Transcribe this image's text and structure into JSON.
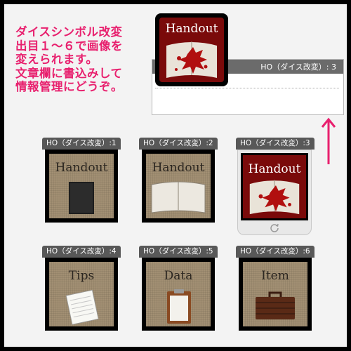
{
  "instructions": {
    "lines": [
      "ダイスシンボル改変",
      "出目１～６で画像を",
      "変えられます。",
      "文章欄に書込みして",
      "情報管理にどうぞ。"
    ]
  },
  "top_card": {
    "title": "Handout"
  },
  "panel": {
    "header": "HO（ダイス改変）: 3"
  },
  "cards": [
    {
      "label": "HO（ダイス改変）:1",
      "title": "Handout",
      "image": "closed-book-icon"
    },
    {
      "label": "HO（ダイス改変）:2",
      "title": "Handout",
      "image": "open-book-icon"
    },
    {
      "label": "HO（ダイス改変）:3",
      "title": "Handout",
      "image": "blood-book-icon"
    },
    {
      "label": "HO（ダイス改変）:4",
      "title": "Tips",
      "image": "notepaper-icon"
    },
    {
      "label": "HO（ダイス改変）:5",
      "title": "Data",
      "image": "clipboard-icon"
    },
    {
      "label": "HO（ダイス改変）:6",
      "title": "Item",
      "image": "briefcase-icon"
    }
  ],
  "colors": {
    "accent": "#e8206e",
    "label_bg": "#585858",
    "blood": "#b10f0f"
  }
}
